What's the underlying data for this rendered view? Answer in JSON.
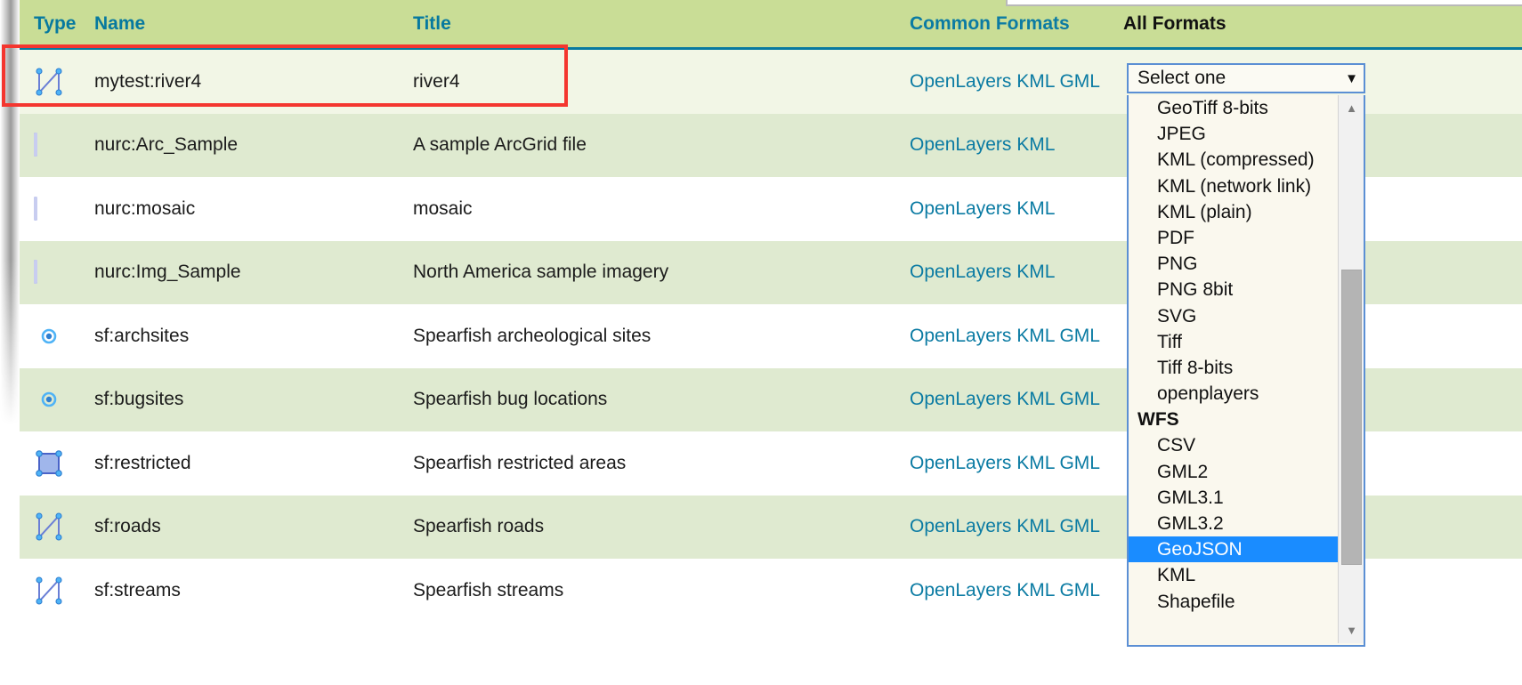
{
  "table": {
    "headers": [
      {
        "key": "type",
        "label": "Type",
        "sortable": true
      },
      {
        "key": "name",
        "label": "Name",
        "sortable": true
      },
      {
        "key": "title",
        "label": "Title",
        "sortable": true
      },
      {
        "key": "common",
        "label": "Common Formats",
        "sortable": false
      },
      {
        "key": "all",
        "label": "All Formats",
        "sortable": false
      }
    ],
    "rows": [
      {
        "icon": "line-geometry-icon",
        "name": "mytest:river4",
        "title": "river4",
        "common": "OpenLayers KML GML",
        "highlighted": true
      },
      {
        "icon": "raster-geometry-icon",
        "name": "nurc:Arc_Sample",
        "title": "A sample ArcGrid file",
        "common": "OpenLayers KML"
      },
      {
        "icon": "raster-geometry-icon",
        "name": "nurc:mosaic",
        "title": "mosaic",
        "common": "OpenLayers KML"
      },
      {
        "icon": "raster-geometry-icon",
        "name": "nurc:Img_Sample",
        "title": "North America sample imagery",
        "common": "OpenLayers KML"
      },
      {
        "icon": "point-geometry-icon",
        "name": "sf:archsites",
        "title": "Spearfish archeological sites",
        "common": "OpenLayers KML GML"
      },
      {
        "icon": "point-geometry-icon",
        "name": "sf:bugsites",
        "title": "Spearfish bug locations",
        "common": "OpenLayers KML GML"
      },
      {
        "icon": "polygon-geometry-icon",
        "name": "sf:restricted",
        "title": "Spearfish restricted areas",
        "common": "OpenLayers KML GML"
      },
      {
        "icon": "line-geometry-icon",
        "name": "sf:roads",
        "title": "Spearfish roads",
        "common": "OpenLayers KML GML"
      },
      {
        "icon": "line-geometry-icon",
        "name": "sf:streams",
        "title": "Spearfish streams",
        "common": "OpenLayers KML GML"
      }
    ]
  },
  "format_select": {
    "selected_label": "Select one",
    "caret_icon": "chevron-down-icon",
    "options": [
      {
        "label": "GeoTiff 8-bits",
        "group": false,
        "selected": false
      },
      {
        "label": "JPEG",
        "group": false,
        "selected": false
      },
      {
        "label": "KML (compressed)",
        "group": false,
        "selected": false
      },
      {
        "label": "KML (network link)",
        "group": false,
        "selected": false
      },
      {
        "label": "KML (plain)",
        "group": false,
        "selected": false
      },
      {
        "label": "PDF",
        "group": false,
        "selected": false
      },
      {
        "label": "PNG",
        "group": false,
        "selected": false
      },
      {
        "label": "PNG 8bit",
        "group": false,
        "selected": false
      },
      {
        "label": "SVG",
        "group": false,
        "selected": false
      },
      {
        "label": "Tiff",
        "group": false,
        "selected": false
      },
      {
        "label": "Tiff 8-bits",
        "group": false,
        "selected": false
      },
      {
        "label": "openplayers",
        "group": false,
        "selected": false
      },
      {
        "label": "WFS",
        "group": true,
        "selected": false
      },
      {
        "label": "CSV",
        "group": false,
        "selected": false
      },
      {
        "label": "GML2",
        "group": false,
        "selected": false
      },
      {
        "label": "GML3.1",
        "group": false,
        "selected": false
      },
      {
        "label": "GML3.2",
        "group": false,
        "selected": false
      },
      {
        "label": "GeoJSON",
        "group": false,
        "selected": true
      },
      {
        "label": "KML",
        "group": false,
        "selected": false
      },
      {
        "label": "Shapefile",
        "group": false,
        "selected": false
      }
    ],
    "scrollbar": {
      "up_arrow_icon": "scroll-up-arrow-icon",
      "down_arrow_icon": "scroll-down-arrow-icon",
      "up_arrow_glyph": "▲",
      "down_arrow_glyph": "▼"
    }
  },
  "annotation": {
    "highlight_color": "#f4362f"
  },
  "colors": {
    "header_bg": "#c9dd96",
    "header_link": "#06799f",
    "header_rule": "#06799f",
    "row_even_bg": "#dfead0",
    "row_first_bg": "#f2f6e6",
    "format_link": "#0b7ba3",
    "option_selected_bg": "#1a8cff",
    "select_border": "#5b8fd4"
  }
}
